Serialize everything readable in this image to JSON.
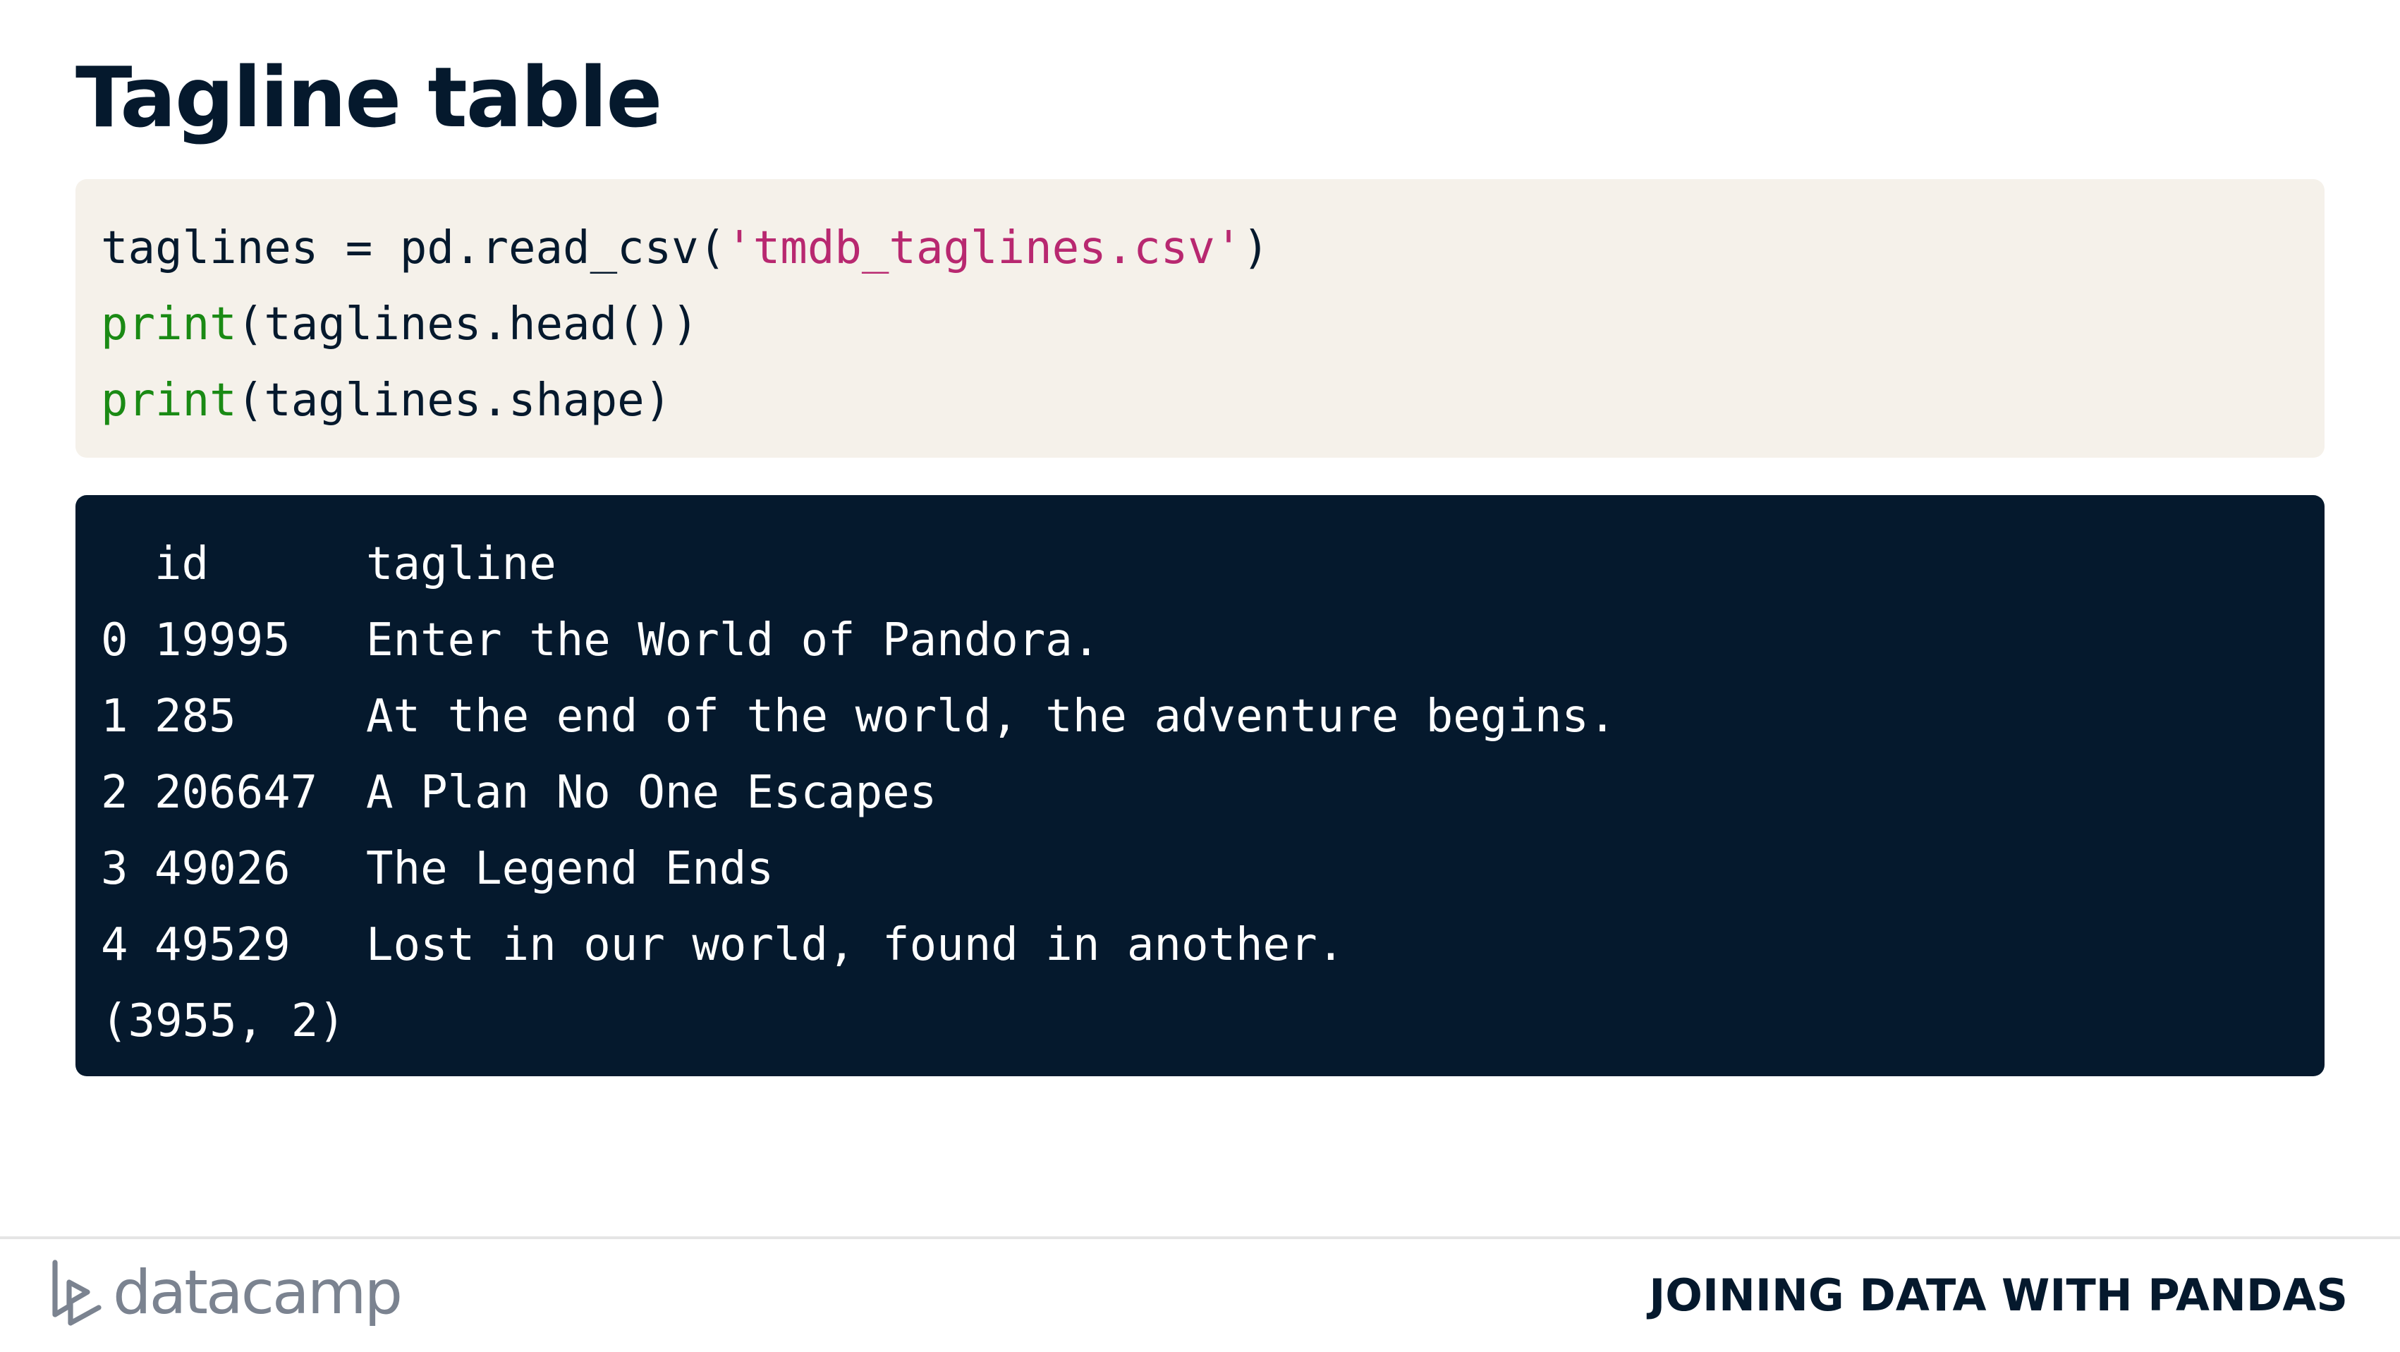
{
  "title": "Tagline table",
  "code": {
    "lines": [
      [
        {
          "text": "taglines = pd.read_csv(",
          "kind": "plain"
        },
        {
          "text": "'tmdb_taglines.csv'",
          "kind": "string"
        },
        {
          "text": ")",
          "kind": "plain"
        }
      ],
      [
        {
          "text": "print",
          "kind": "function"
        },
        {
          "text": "(taglines.head())",
          "kind": "plain"
        }
      ],
      [
        {
          "text": "print",
          "kind": "function"
        },
        {
          "text": "(taglines.shape)",
          "kind": "plain"
        }
      ]
    ]
  },
  "output": {
    "columns": [
      "id",
      "tagline"
    ],
    "rows": [
      {
        "index": "0",
        "id": "19995",
        "tagline": "Enter the World of Pandora."
      },
      {
        "index": "1",
        "id": "285",
        "tagline": "At the end of the world, the adventure begins."
      },
      {
        "index": "2",
        "id": "206647",
        "tagline": "A Plan No One Escapes"
      },
      {
        "index": "3",
        "id": "49026",
        "tagline": "The Legend Ends"
      },
      {
        "index": "4",
        "id": "49529",
        "tagline": "Lost in our world, found in another."
      }
    ],
    "shape": "(3955, 2)"
  },
  "footer": {
    "brand": "datacamp",
    "brand_icon": "datacamp-logo-icon",
    "course": "JOINING DATA WITH PANDAS"
  },
  "colors": {
    "navy": "#05192d",
    "code_bg": "#f5f1ea",
    "function": "#1a8a14",
    "string": "#b82870",
    "brand_gray": "#7b8390"
  }
}
